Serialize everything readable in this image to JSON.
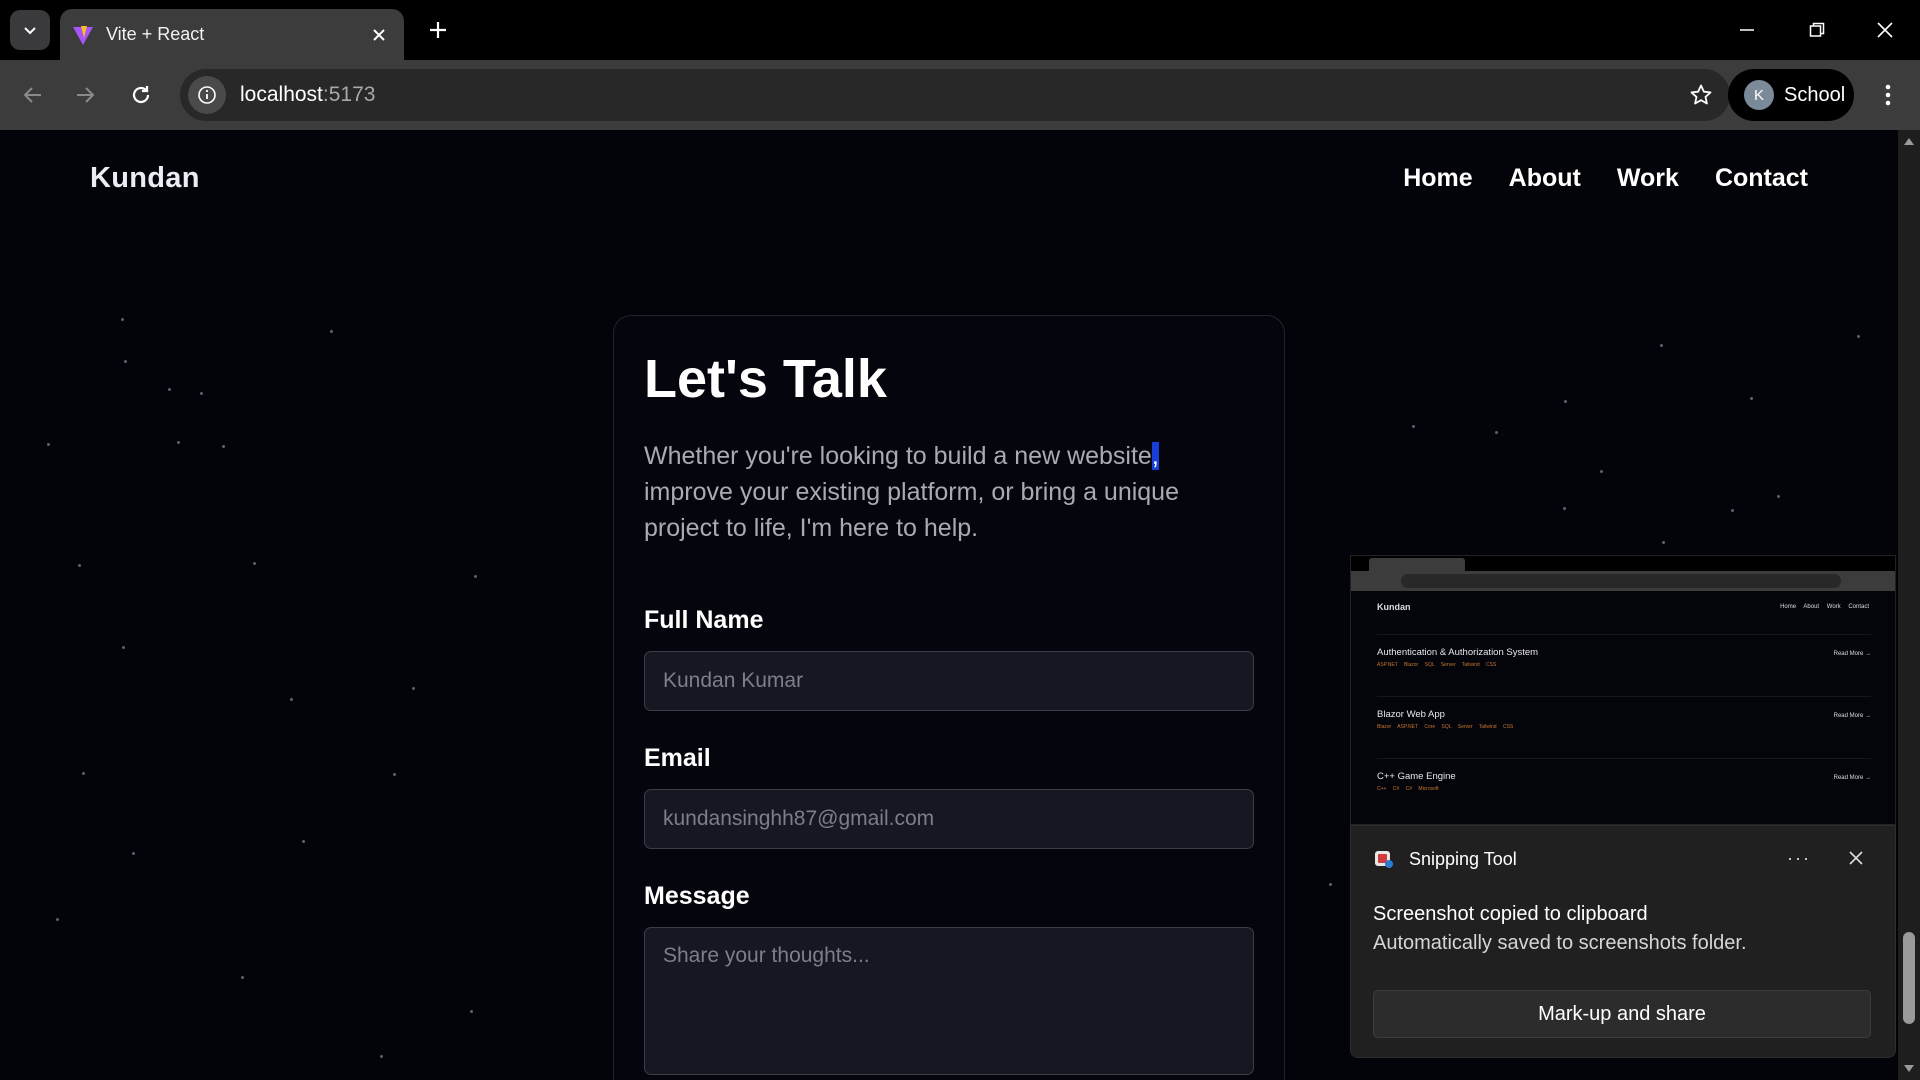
{
  "browser": {
    "tab_title": "Vite + React",
    "url_host": "localhost",
    "url_port": ":5173",
    "profile_initial": "K",
    "profile_label": "School"
  },
  "site": {
    "logo": "Kundan",
    "nav": [
      "Home",
      "About",
      "Work",
      "Contact"
    ]
  },
  "contact": {
    "title": "Let's Talk",
    "description_before": "Whether you're looking to build a new website",
    "description_selected": ",",
    "description_after": " improve your existing platform, or bring a unique project to life, I'm here to help.",
    "full_name_label": "Full Name",
    "full_name_placeholder": "Kundan Kumar",
    "email_label": "Email",
    "email_placeholder": "kundansinghh87@gmail.com",
    "message_label": "Message",
    "message_placeholder": "Share your thoughts..."
  },
  "preview": {
    "logo": "Kundan",
    "nav": "Home About Work Contact",
    "items": [
      {
        "title": "Authentication & Authorization System",
        "tags": "ASP.NET Blazor SQL Server Tailwind CSS",
        "link": "Read More →"
      },
      {
        "title": "Blazor Web App",
        "tags": "Blazor ASP.NET Core SQL Server Tailwind CSS",
        "link": "Read More →"
      },
      {
        "title": "C++ Game Engine",
        "tags": "C++ C# C# Microsoft",
        "link": "Read More →"
      }
    ]
  },
  "toast": {
    "app_name": "Snipping Tool",
    "more": "···",
    "title": "Screenshot copied to clipboard",
    "body": "Automatically saved to screenshots folder.",
    "button": "Mark-up and share"
  },
  "colors": {
    "page_bg": "#03030a",
    "input_bg": "#161821",
    "selection": "#1a3fd6",
    "tag_accent": "#c9762e"
  }
}
